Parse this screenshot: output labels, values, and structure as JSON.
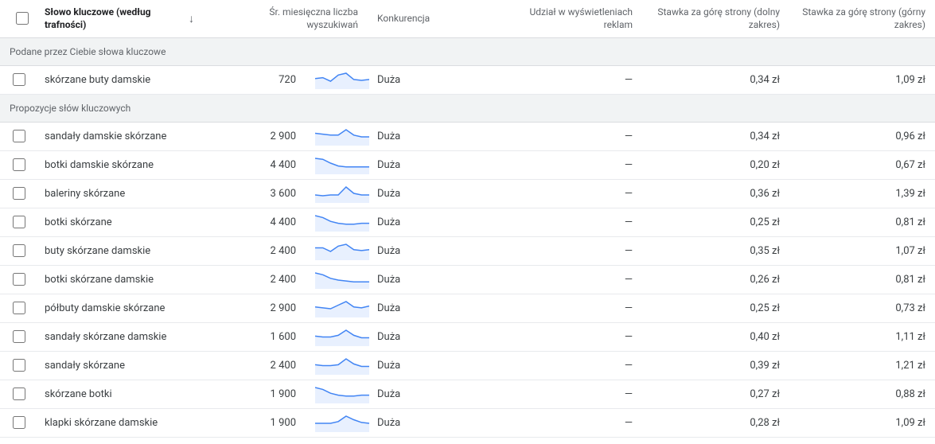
{
  "headers": {
    "keyword": "Słowo kluczowe (według trafności)",
    "searches": "Śr. miesięczna liczba wyszukiwań",
    "competition": "Konkurencja",
    "ad_share": "Udział w wyświetleniach reklam",
    "bid_low": "Stawka za górę strony (dolny zakres)",
    "bid_high": "Stawka za górę strony (górny zakres)"
  },
  "sections": {
    "provided": "Podane przez Ciebie słowa kluczowe",
    "suggestions": "Propozycje słów kluczowych"
  },
  "dash": "—",
  "provided_rows": [
    {
      "keyword": "skórzane buty damskie",
      "searches": "720",
      "competition": "Duża",
      "bid_low": "0,34 zł",
      "bid_high": "1,09 zł",
      "spark": [
        10,
        11,
        7,
        14,
        16,
        9,
        8,
        9
      ]
    }
  ],
  "suggestion_rows": [
    {
      "keyword": "sandały damskie skórzane",
      "searches": "2 900",
      "competition": "Duża",
      "bid_low": "0,34 zł",
      "bid_high": "0,96 zł",
      "spark": [
        12,
        11,
        10,
        10,
        16,
        10,
        8,
        8
      ]
    },
    {
      "keyword": "botki damskie skórzane",
      "searches": "4 400",
      "competition": "Duża",
      "bid_low": "0,20 zł",
      "bid_high": "0,67 zł",
      "spark": [
        15,
        14,
        10,
        7,
        6,
        6,
        6,
        6
      ]
    },
    {
      "keyword": "baleriny skórzane",
      "searches": "3 600",
      "competition": "Duża",
      "bid_low": "0,36 zł",
      "bid_high": "1,39 zł",
      "spark": [
        8,
        7,
        8,
        8,
        18,
        10,
        8,
        8
      ]
    },
    {
      "keyword": "botki skórzane",
      "searches": "4 400",
      "competition": "Duża",
      "bid_low": "0,25 zł",
      "bid_high": "0,81 zł",
      "spark": [
        15,
        13,
        9,
        7,
        6,
        6,
        7,
        7
      ]
    },
    {
      "keyword": "buty skórzane damskie",
      "searches": "2 400",
      "competition": "Duża",
      "bid_low": "0,35 zł",
      "bid_high": "1,07 zł",
      "spark": [
        12,
        12,
        8,
        14,
        16,
        10,
        9,
        10
      ]
    },
    {
      "keyword": "botki skórzane damskie",
      "searches": "2 400",
      "competition": "Duża",
      "bid_low": "0,26 zł",
      "bid_high": "0,81 zł",
      "spark": [
        16,
        14,
        10,
        8,
        7,
        6,
        6,
        6
      ]
    },
    {
      "keyword": "półbuty damskie skórzane",
      "searches": "2 900",
      "competition": "Duża",
      "bid_low": "0,25 zł",
      "bid_high": "0,73 zł",
      "spark": [
        10,
        9,
        8,
        12,
        16,
        10,
        9,
        11
      ]
    },
    {
      "keyword": "sandały skórzane damskie",
      "searches": "1 600",
      "competition": "Duża",
      "bid_low": "0,40 zł",
      "bid_high": "1,11 zł",
      "spark": [
        10,
        9,
        9,
        11,
        17,
        11,
        8,
        8
      ]
    },
    {
      "keyword": "sandały skórzane",
      "searches": "2 400",
      "competition": "Duża",
      "bid_low": "0,39 zł",
      "bid_high": "1,21 zł",
      "spark": [
        10,
        9,
        9,
        10,
        17,
        11,
        8,
        8
      ]
    },
    {
      "keyword": "skórzane botki",
      "searches": "1 900",
      "competition": "Duża",
      "bid_low": "0,27 zł",
      "bid_high": "0,88 zł",
      "spark": [
        15,
        13,
        9,
        7,
        6,
        6,
        7,
        7
      ]
    },
    {
      "keyword": "klapki skórzane damskie",
      "searches": "1 900",
      "competition": "Duża",
      "bid_low": "0,28 zł",
      "bid_high": "1,09 zł",
      "spark": [
        8,
        8,
        8,
        10,
        16,
        12,
        9,
        8
      ]
    }
  ]
}
